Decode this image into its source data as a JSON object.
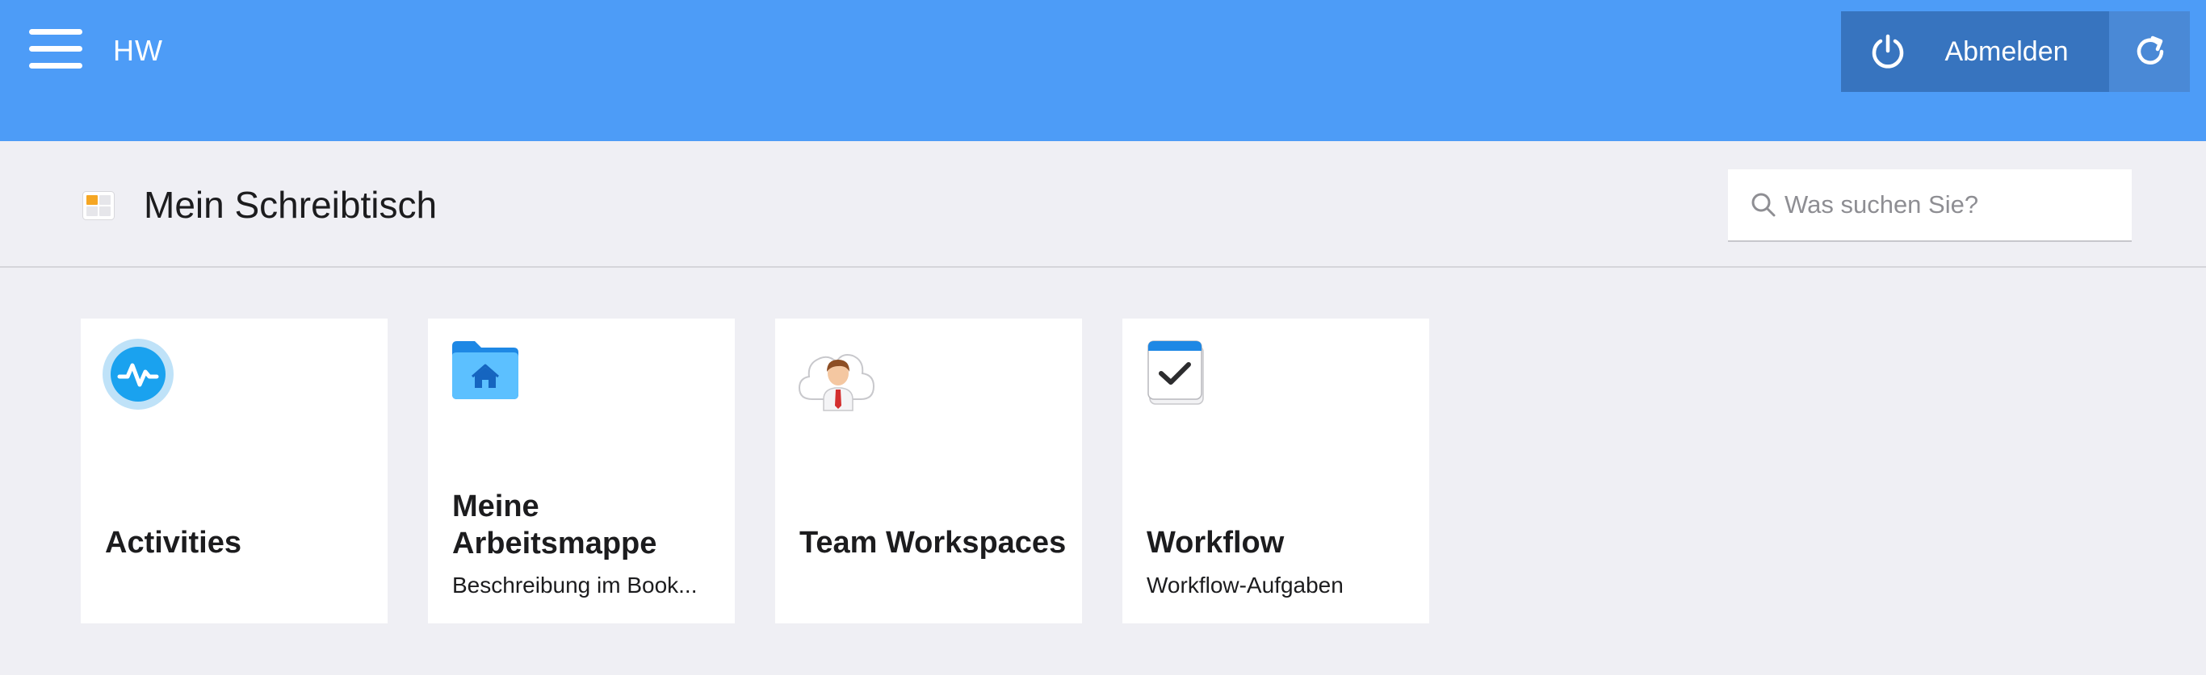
{
  "header": {
    "app_title": "HW",
    "logout_label": "Abmelden"
  },
  "subheader": {
    "page_title": "Mein Schreibtisch",
    "search": {
      "placeholder": "Was suchen Sie?",
      "value": ""
    }
  },
  "icons": {
    "menu": "hamburger-menu-icon",
    "logout": "power-icon",
    "refresh": "refresh-icon",
    "page": "dashboard-icon",
    "search": "search-icon"
  },
  "colors": {
    "topbar": "#4d9cf7",
    "logout_button": "#3774bf",
    "refresh_button": "#4a89d6",
    "background": "#efeff4",
    "tile": "#ffffff"
  },
  "tiles": [
    {
      "title": "Activities",
      "subtitle": "",
      "icon": "activity-pulse-icon"
    },
    {
      "title": "Meine Arbeitsmappe",
      "subtitle": "Beschreibung im Book...",
      "icon": "home-folder-icon"
    },
    {
      "title": "Team Workspaces",
      "subtitle": "",
      "icon": "cloud-user-icon"
    },
    {
      "title": "Workflow",
      "subtitle": "Workflow-Aufgaben",
      "icon": "calendar-check-icon"
    }
  ]
}
